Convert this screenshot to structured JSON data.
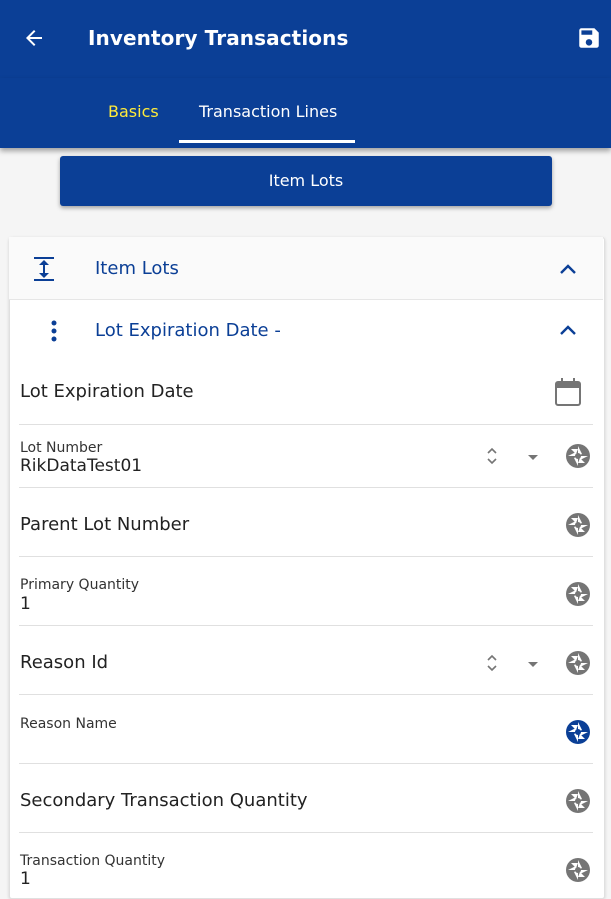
{
  "appbar": {
    "title": "Inventory Transactions"
  },
  "tabs": [
    {
      "label": "Basics"
    },
    {
      "label": "Transaction Lines"
    }
  ],
  "item_lots_button": "Item Lots",
  "section": {
    "title": "Item Lots",
    "subsection": {
      "title": "Lot Expiration Date  -"
    }
  },
  "fields": {
    "lot_expiration_date": {
      "label": "Lot Expiration Date"
    },
    "lot_number": {
      "label": "Lot Number",
      "value": "RikDataTest01"
    },
    "parent_lot_number": {
      "label": "Parent Lot Number"
    },
    "primary_quantity": {
      "label": "Primary Quantity",
      "value": "1"
    },
    "reason_id": {
      "label": "Reason Id"
    },
    "reason_name": {
      "label": "Reason Name",
      "value": ""
    },
    "secondary_transaction_quantity": {
      "label": "Secondary Transaction Quantity"
    },
    "transaction_quantity": {
      "label": "Transaction Quantity",
      "value": "1"
    }
  },
  "colors": {
    "primary": "#0b3f96",
    "active_tab_text": "#ffeb3b",
    "icon_grey": "#757575"
  },
  "icons": [
    "arrow-back-icon",
    "save-icon",
    "expand-vertical-icon",
    "chevron-up-icon",
    "more-vert-icon",
    "calendar-icon",
    "sort-icon",
    "dropdown-icon",
    "camera-aperture-icon"
  ]
}
